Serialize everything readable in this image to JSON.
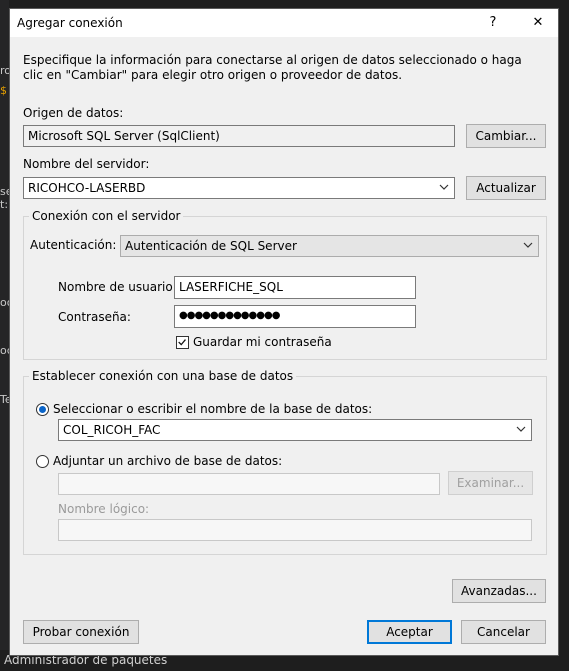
{
  "background": {
    "side_fragments": [
      "ro",
      "$",
      "se",
      "t:",
      "oo",
      "oc",
      "Te"
    ],
    "bottom_text": "Administrador de paquetes"
  },
  "dialog": {
    "title": "Agregar conexión",
    "help_glyph": "?",
    "close_glyph": "✕",
    "intro": "Especifique la información para conectarse al origen de datos seleccionado o haga clic en \"Cambiar\" para elegir otro origen o proveedor de datos.",
    "data_source": {
      "label": "Origen de datos:",
      "value": "Microsoft SQL Server (SqlClient)",
      "change_button": "Cambiar..."
    },
    "server": {
      "label": "Nombre del servidor:",
      "value": "RICOHCO-LASERBD",
      "refresh_button": "Actualizar"
    },
    "connection_group": {
      "title": "Conexión con el servidor",
      "auth_label": "Autenticación:",
      "auth_value": "Autenticación de SQL Server",
      "username_label": "Nombre de usuario:",
      "username_value": "LASERFICHE_SQL",
      "password_label": "Contraseña:",
      "password_value": "●●●●●●●●●●●●●",
      "save_password_label": "Guardar mi contraseña",
      "save_password_checked": true
    },
    "database_group": {
      "title": "Establecer conexión con una base de datos",
      "option_select_label": "Seleccionar o escribir el nombre de la base de datos:",
      "option_select_checked": true,
      "database_value": "COL_RICOH_FAC",
      "option_attach_label": "Adjuntar un archivo de base de datos:",
      "option_attach_checked": false,
      "browse_button": "Examinar...",
      "logical_name_label": "Nombre lógico:"
    },
    "advanced_button": "Avanzadas...",
    "test_button": "Probar conexión",
    "ok_button": "Aceptar",
    "cancel_button": "Cancelar"
  },
  "colors": {
    "accent": "#0078d7",
    "dialog_bg": "#f0f0f0",
    "ide_bg": "#1e1e1e"
  }
}
